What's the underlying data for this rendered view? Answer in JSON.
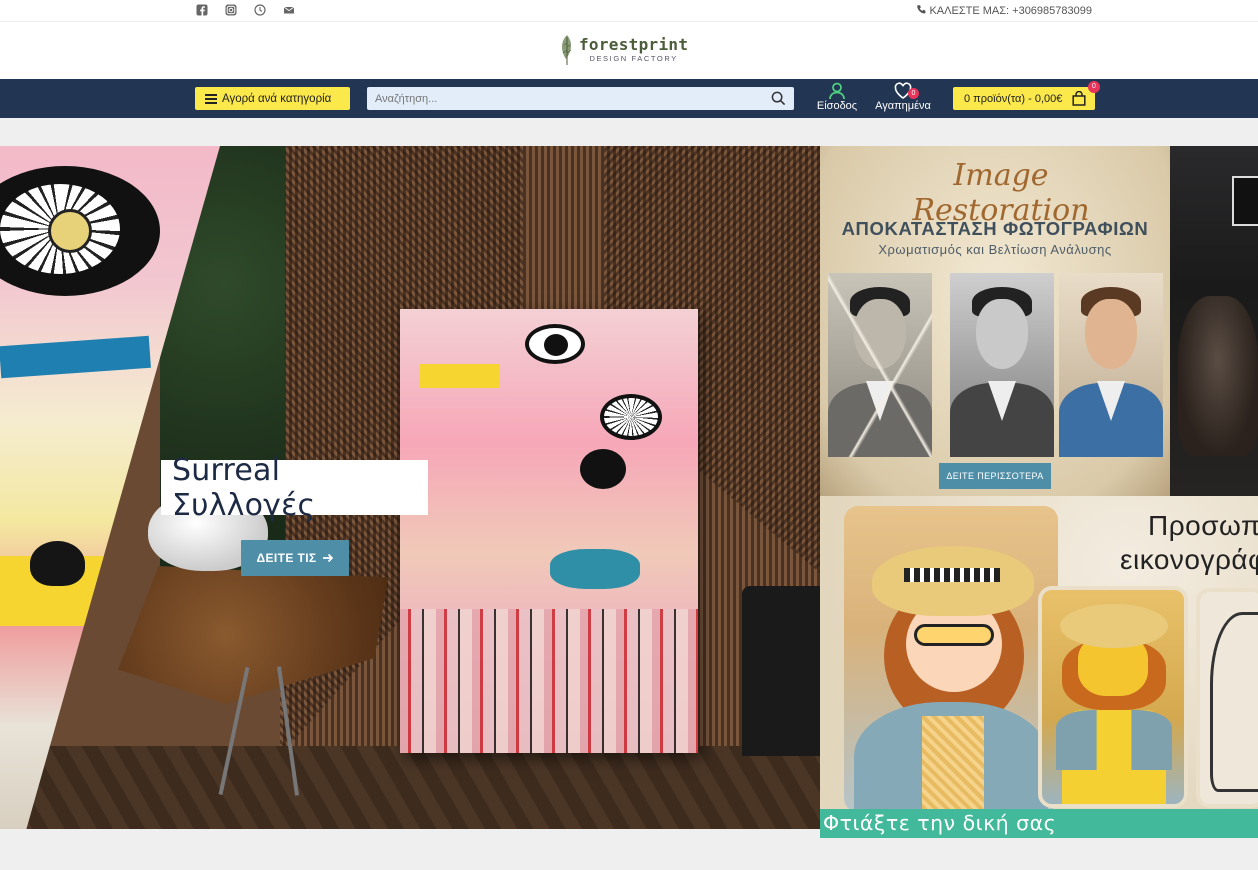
{
  "topbar": {
    "social_icons": [
      "facebook-icon",
      "instagram-icon",
      "whatsapp-icon",
      "email-icon"
    ],
    "call_label": "ΚΑΛΕΣΤΕ ΜΑΣ: +306985783099"
  },
  "logo": {
    "name": "forestprint",
    "tagline": "DESIGN FACTORY"
  },
  "nav": {
    "category_button": "Αγορά ανά κατηγορία",
    "search_placeholder": "Αναζήτηση...",
    "login_label": "Είσοδος",
    "favorites_label": "Αγαπημένα",
    "favorites_count": "0",
    "cart_label": "0 προϊόν(τα) - 0,00€",
    "cart_count": "0"
  },
  "hero": {
    "title": "Surreal Συλλογές",
    "button_label": "ΔΕΙΤΕ ΤΙΣ"
  },
  "banner_restore": {
    "script_title": "Image Restoration",
    "title": "ΑΠΟΚΑΤΑΣΤΑΣΗ ΦΩΤΟΓΡΑΦΙΩΝ",
    "subtitle": "Χρωματισμός και Βελτίωση Ανάλυσης",
    "button_label": "ΔΕΙΤΕ ΠΕΡΙΣΣΟΤΕΡΑ"
  },
  "banner_portrait": {
    "title_line1": "Προσωπ",
    "title_line2": "εικονογράφ",
    "caption": "Φτιάξτε την δική σας"
  },
  "colors": {
    "nav_bg": "#223553",
    "accent_yellow": "#fbe84a",
    "button_blue": "#4f8ea7",
    "badge_red": "#e6345a",
    "caption_green": "#43b99b"
  }
}
